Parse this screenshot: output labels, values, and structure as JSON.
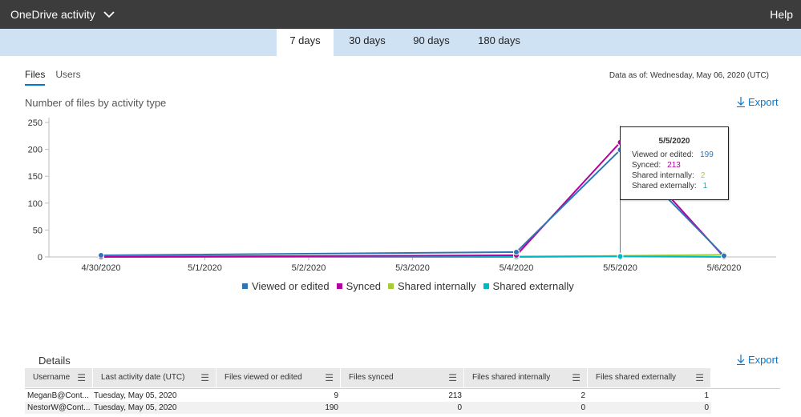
{
  "header": {
    "title": "OneDrive activity",
    "help": "Help"
  },
  "range_tabs": [
    {
      "label": "7 days",
      "active": true
    },
    {
      "label": "30 days",
      "active": false
    },
    {
      "label": "90 days",
      "active": false
    },
    {
      "label": "180 days",
      "active": false
    }
  ],
  "sub_tabs": [
    {
      "label": "Files",
      "active": true
    },
    {
      "label": "Users",
      "active": false
    }
  ],
  "data_as_of": "Data as of: Wednesday, May 06, 2020 (UTC)",
  "chart_section": {
    "title": "Number of files by activity type",
    "export": "Export"
  },
  "chart_data": {
    "type": "line",
    "title": "Number of files by activity type",
    "categories": [
      "4/30/2020",
      "5/1/2020",
      "5/2/2020",
      "5/3/2020",
      "5/4/2020",
      "5/5/2020",
      "5/6/2020"
    ],
    "x_dates": [
      "4/30/2020",
      "5/4/2020",
      "5/5/2020",
      "5/6/2020"
    ],
    "ylim": [
      0,
      250
    ],
    "yticks": [
      "250",
      "200",
      "150",
      "100",
      "50",
      "0"
    ],
    "grid": false,
    "legend_position": "bottom",
    "series": [
      {
        "name": "Viewed or edited",
        "color": "#2e75b6",
        "values": [
          3,
          9,
          199,
          2
        ]
      },
      {
        "name": "Synced",
        "color": "#b4009e",
        "values": [
          0,
          3,
          213,
          0
        ]
      },
      {
        "name": "Shared internally",
        "color": "#a4cc3a",
        "values": [
          2,
          1,
          2,
          4
        ]
      },
      {
        "name": "Shared externally",
        "color": "#00b7c3",
        "values": [
          0,
          0,
          1,
          0
        ]
      }
    ]
  },
  "tooltip": {
    "date": "5/5/2020",
    "rows": [
      {
        "label": "Viewed or edited:",
        "value": "199",
        "color": "#2e75b6"
      },
      {
        "label": "Synced:",
        "value": "213",
        "color": "#b4009e"
      },
      {
        "label": "Shared internally:",
        "value": "2",
        "color": "#a4cc3a"
      },
      {
        "label": "Shared externally:",
        "value": "1",
        "color": "#00b7c3"
      }
    ]
  },
  "details": {
    "title": "Details",
    "export": "Export",
    "columns": [
      "Username",
      "Last activity date (UTC)",
      "Files viewed or edited",
      "Files synced",
      "Files shared internally",
      "Files shared externally"
    ],
    "rows": [
      [
        "MeganB@Cont...",
        "Tuesday, May 05, 2020",
        "9",
        "213",
        "2",
        "1"
      ],
      [
        "NestorW@Cont...",
        "Tuesday, May 05, 2020",
        "190",
        "0",
        "0",
        "0"
      ]
    ]
  }
}
